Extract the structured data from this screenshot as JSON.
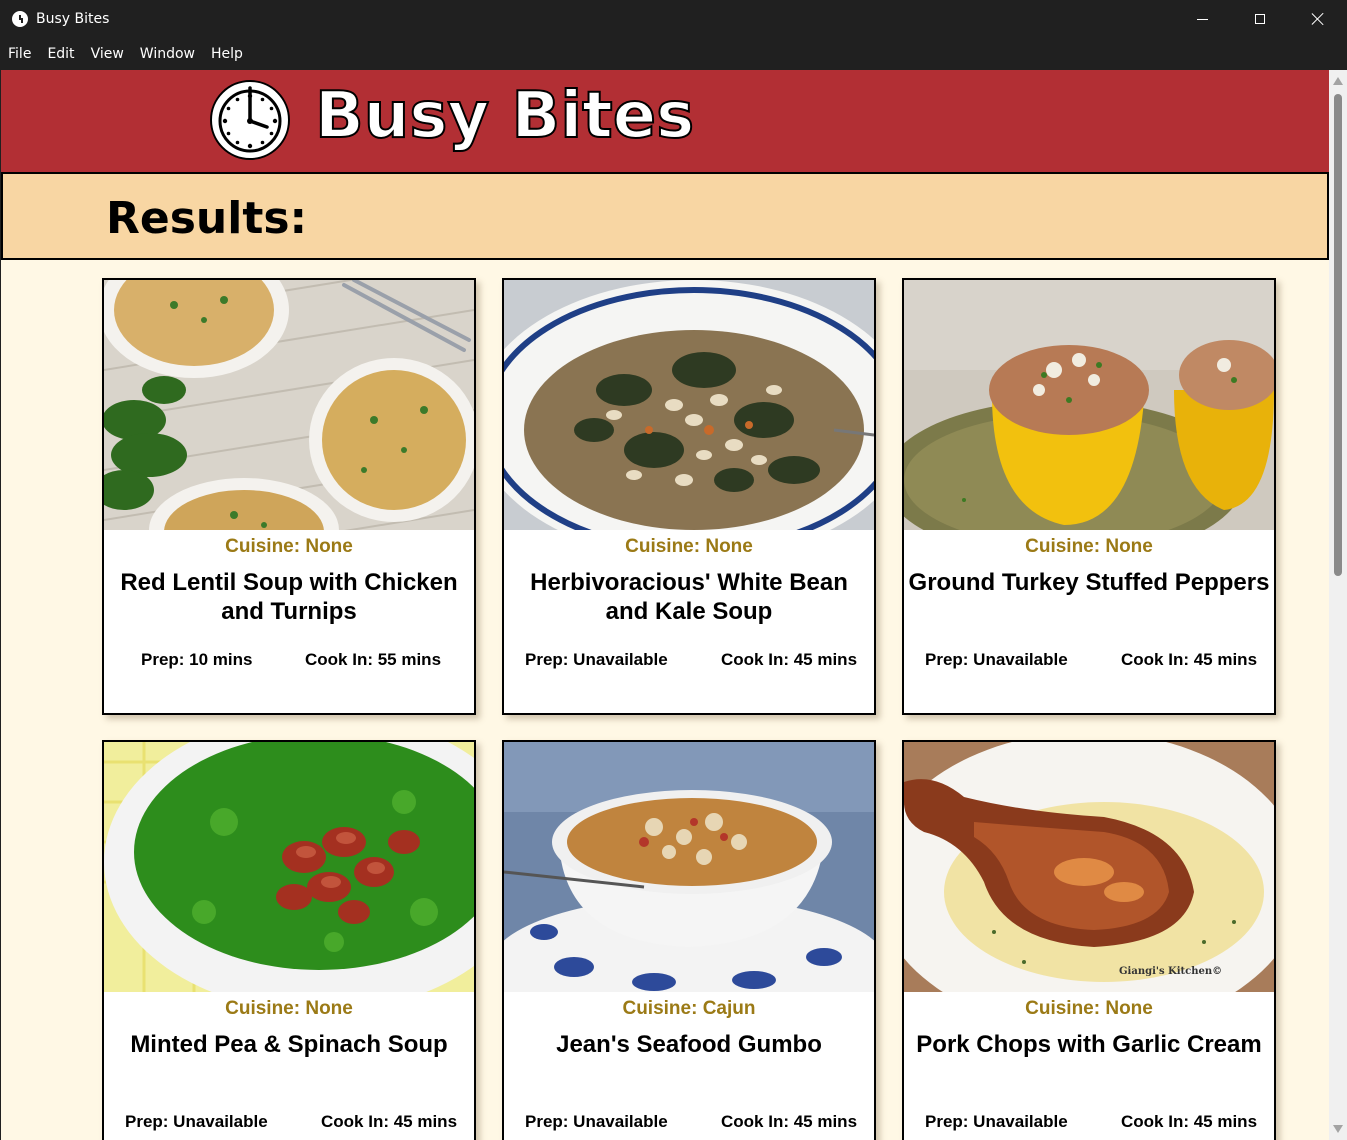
{
  "window": {
    "title": "Busy Bites"
  },
  "menu": [
    "File",
    "Edit",
    "View",
    "Window",
    "Help"
  ],
  "header": {
    "logo_text": "Busy Bites"
  },
  "results": {
    "title": "Results:"
  },
  "cards": [
    {
      "cuisine": "Cuisine: None",
      "title": "Red Lentil Soup with Chicken and Turnips",
      "prep": "Prep: 10 mins",
      "cook": "Cook In: 55 mins",
      "image": "lentil-soup-photo"
    },
    {
      "cuisine": "Cuisine: None",
      "title": "Herbivoracious' White Bean and Kale Soup",
      "prep": "Prep: Unavailable",
      "cook": "Cook In: 45 mins",
      "image": "bean-kale-soup-photo"
    },
    {
      "cuisine": "Cuisine: None",
      "title": "Ground Turkey Stuffed Peppers",
      "prep": "Prep: Unavailable",
      "cook": "Cook In: 45 mins",
      "image": "stuffed-peppers-photo"
    },
    {
      "cuisine": "Cuisine: None",
      "title": "Minted Pea & Spinach Soup",
      "prep": "Prep: Unavailable",
      "cook": "Cook In: 45 mins",
      "image": "pea-spinach-soup-photo"
    },
    {
      "cuisine": "Cuisine: Cajun",
      "title": "Jean's Seafood Gumbo",
      "prep": "Prep: Unavailable",
      "cook": "Cook In: 45 mins",
      "image": "seafood-gumbo-photo"
    },
    {
      "cuisine": "Cuisine: None",
      "title": "Pork Chops with Garlic Cream",
      "prep": "Prep: Unavailable",
      "cook": "Cook In: 45 mins",
      "image": "pork-chop-photo",
      "watermark": "Giangi's Kitchen©"
    }
  ],
  "colors": {
    "header_red": "#b22f34",
    "results_bar": "#f8d6a3",
    "page_background": "#fff8e5",
    "cuisine_text": "#9b7a16"
  }
}
